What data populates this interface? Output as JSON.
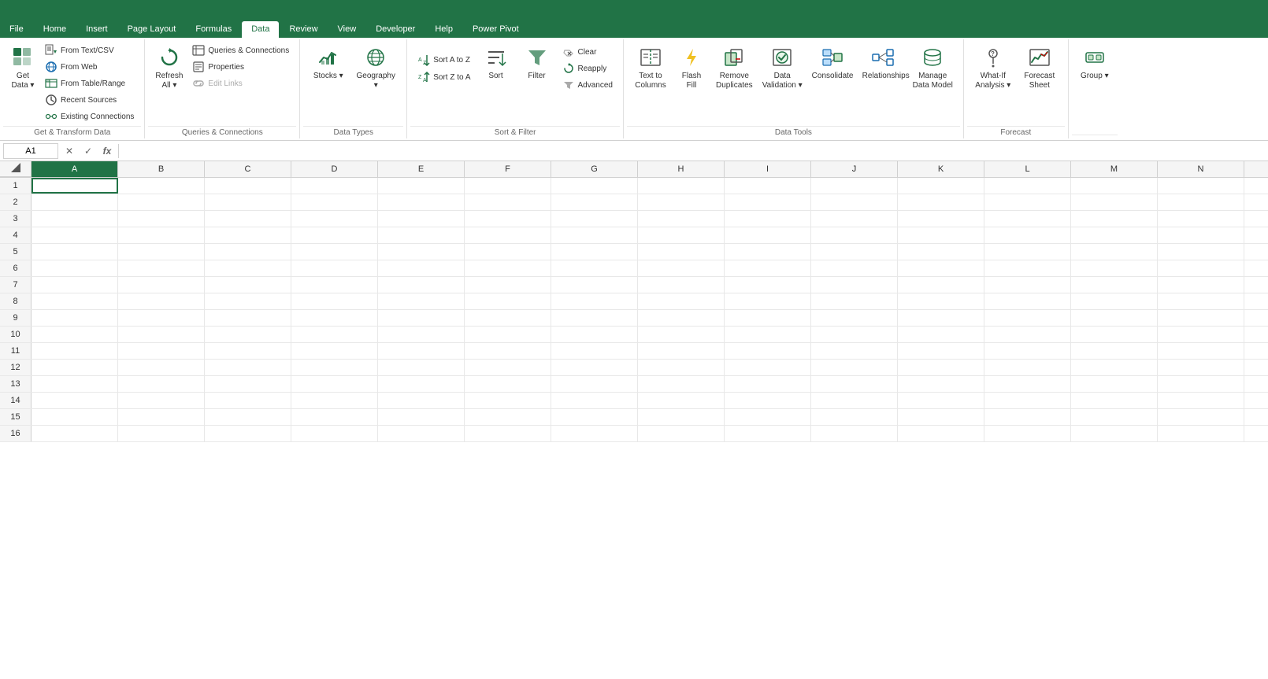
{
  "menu": {
    "items": [
      "File",
      "Home",
      "Insert",
      "Page Layout",
      "Formulas",
      "Data",
      "Review",
      "View",
      "Developer",
      "Help",
      "Power Pivot"
    ],
    "active": "Data"
  },
  "ribbon": {
    "groups": [
      {
        "label": "Get & Transform Data",
        "buttons": [
          {
            "id": "get-data",
            "icon": "📋",
            "label": "Get\nData",
            "has_arrow": true
          },
          {
            "id": "from-text-csv",
            "icon": "📄",
            "label": "From\nText/CSV"
          },
          {
            "id": "from-web",
            "icon": "🌐",
            "label": "From\nWeb"
          },
          {
            "id": "from-table-range",
            "icon": "📊",
            "label": "From Table/\nRange"
          },
          {
            "id": "recent-sources",
            "icon": "🕐",
            "label": "Recent\nSources"
          },
          {
            "id": "existing-connections",
            "icon": "🔗",
            "label": "Existing\nConnections"
          }
        ]
      },
      {
        "label": "Queries & Connections",
        "buttons": [
          {
            "id": "refresh-all",
            "icon": "🔄",
            "label": "Refresh\nAll",
            "has_arrow": true
          },
          {
            "id": "queries-connections",
            "icon": "🔀",
            "label": "Queries &\nConnections"
          },
          {
            "id": "properties",
            "icon": "📋",
            "label": "Properties"
          },
          {
            "id": "edit-links",
            "icon": "🔗",
            "label": "Edit Links"
          }
        ]
      },
      {
        "label": "Data Types",
        "buttons": [
          {
            "id": "stocks",
            "icon": "📈",
            "label": "Stocks",
            "has_dropdown": true
          },
          {
            "id": "geography",
            "icon": "🌍",
            "label": "Geography",
            "has_dropdown": true
          }
        ]
      },
      {
        "label": "Sort & Filter",
        "buttons": [
          {
            "id": "sort-asc",
            "icon": "↑",
            "label": "Sort A-Z"
          },
          {
            "id": "sort-desc",
            "icon": "↓",
            "label": "Sort Z-A"
          },
          {
            "id": "sort",
            "icon": "🔀",
            "label": "Sort"
          },
          {
            "id": "filter",
            "icon": "▼",
            "label": "Filter"
          },
          {
            "id": "clear",
            "icon": "✕",
            "label": "Clear"
          },
          {
            "id": "reapply",
            "icon": "↺",
            "label": "Reapply"
          },
          {
            "id": "advanced",
            "icon": "▼",
            "label": "Advanced"
          }
        ]
      },
      {
        "label": "Data Tools",
        "buttons": [
          {
            "id": "text-to-columns",
            "icon": "⬚",
            "label": "Text to\nColumns"
          },
          {
            "id": "flash-fill",
            "icon": "⚡",
            "label": "Flash\nFill"
          },
          {
            "id": "remove-duplicates",
            "icon": "⊟",
            "label": "Remove\nDuplicates"
          },
          {
            "id": "data-validation",
            "icon": "✓",
            "label": "Data\nValidation",
            "has_arrow": true
          },
          {
            "id": "consolidate",
            "icon": "◧",
            "label": "Consolidate"
          },
          {
            "id": "relationships",
            "icon": "↔",
            "label": "Relationships"
          },
          {
            "id": "manage-data-model",
            "icon": "🗄",
            "label": "Manage\nData Model"
          }
        ]
      },
      {
        "label": "Forecast",
        "buttons": [
          {
            "id": "what-if",
            "icon": "❓",
            "label": "What-If\nAnalysis",
            "has_arrow": true
          },
          {
            "id": "forecast-sheet",
            "icon": "📉",
            "label": "Forecast\nSheet"
          }
        ]
      },
      {
        "label": "",
        "buttons": [
          {
            "id": "group",
            "icon": "⊞",
            "label": "Group",
            "has_arrow": true
          }
        ]
      }
    ]
  },
  "formula_bar": {
    "name_box": "A1",
    "cancel_label": "✕",
    "confirm_label": "✓",
    "function_label": "fx",
    "formula_value": ""
  },
  "spreadsheet": {
    "columns": [
      "A",
      "B",
      "C",
      "D",
      "E",
      "F",
      "G",
      "H",
      "I",
      "J",
      "K",
      "L",
      "M",
      "N"
    ],
    "active_cell": "A1",
    "rows": 16
  }
}
